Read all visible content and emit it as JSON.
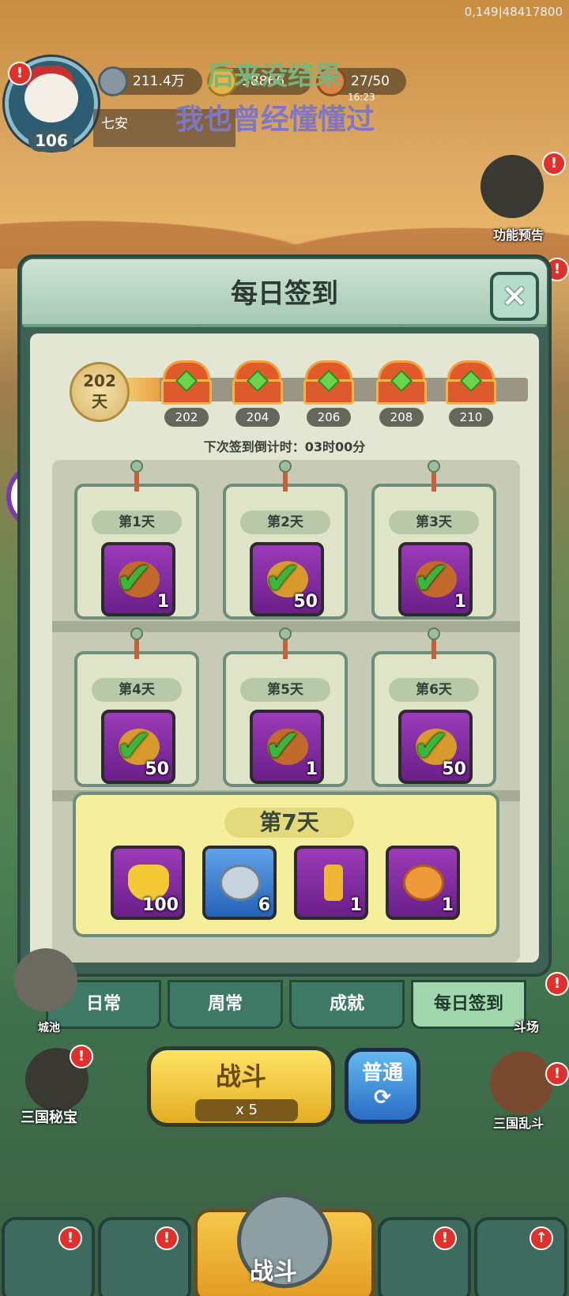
{
  "status_id": "0,149|48417800",
  "player": {
    "level": "106",
    "name": "七安"
  },
  "resources": {
    "silver": "211.4万",
    "gold": "38866",
    "stamina": "27/50",
    "time": "16:23"
  },
  "lyrics": {
    "line1": "后来没结果",
    "line2": "我也曾经懂懂过"
  },
  "side_npcs": {
    "preview": "功能预告",
    "castle": "城池",
    "secret": "三国秘宝",
    "brawl": "三国乱斗",
    "arena": "斗场"
  },
  "dialog": {
    "title": "每日签到",
    "close_icon": "×",
    "progress": {
      "days": "202",
      "unit": "天",
      "chests": [
        "202",
        "204",
        "206",
        "208",
        "210"
      ]
    },
    "countdown": "下次签到倒计时：03时00分",
    "days": [
      {
        "label": "第1天",
        "qty": "1"
      },
      {
        "label": "第2天",
        "qty": "50"
      },
      {
        "label": "第3天",
        "qty": "1"
      },
      {
        "label": "第4天",
        "qty": "50"
      },
      {
        "label": "第5天",
        "qty": "1"
      },
      {
        "label": "第6天",
        "qty": "50"
      }
    ],
    "day7": {
      "label": "第7天",
      "rewards": [
        {
          "qty": "100",
          "icon": "gold-ingot-icon"
        },
        {
          "qty": "6",
          "icon": "silver-coin-icon"
        },
        {
          "qty": "1",
          "icon": "key-icon"
        },
        {
          "qty": "1",
          "icon": "heart-coin-icon"
        }
      ]
    }
  },
  "tabs": [
    "日常",
    "周常",
    "成就",
    "每日签到"
  ],
  "active_tab": "每日签到",
  "battle": {
    "label": "战斗",
    "cost": "x 5",
    "mode": "普通"
  },
  "bottom_nav": {
    "center": "战斗"
  },
  "colors": {
    "check": "#3bb53b",
    "purple_item": "#7a2b9a",
    "accent_gold": "#f0c84a"
  }
}
